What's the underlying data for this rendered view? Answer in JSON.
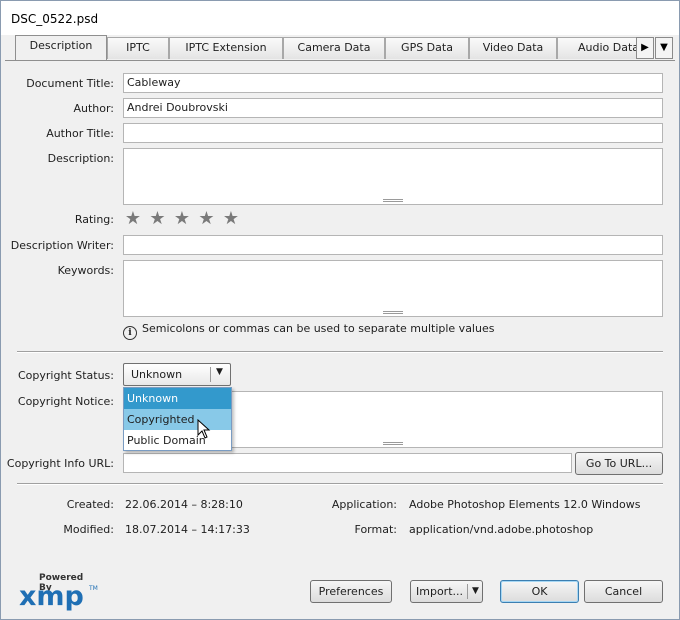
{
  "window": {
    "title": "DSC_0522.psd"
  },
  "tabs": [
    {
      "label": "Description"
    },
    {
      "label": "IPTC"
    },
    {
      "label": "IPTC Extension"
    },
    {
      "label": "Camera Data"
    },
    {
      "label": "GPS Data"
    },
    {
      "label": "Video Data"
    },
    {
      "label": "Audio Data"
    }
  ],
  "active_tab": "Description",
  "tab_scroll": {
    "right_icon": "triangle-right-icon",
    "menu_icon": "triangle-down-icon"
  },
  "form": {
    "document_title": {
      "label": "Document Title:",
      "value": "Cableway"
    },
    "author": {
      "label": "Author:",
      "value": "Andrei Doubrovski"
    },
    "author_title": {
      "label": "Author Title:",
      "value": ""
    },
    "description": {
      "label": "Description:",
      "value": ""
    },
    "rating": {
      "label": "Rating:",
      "stars": 0,
      "max": 5
    },
    "description_writer": {
      "label": "Description Writer:",
      "value": ""
    },
    "keywords": {
      "label": "Keywords:",
      "value": ""
    },
    "keywords_hint": "Semicolons or commas can be used to separate multiple values"
  },
  "copyright": {
    "status_label": "Copyright Status:",
    "status_value": "Unknown",
    "options": [
      "Unknown",
      "Copyrighted",
      "Public Domain"
    ],
    "notice_label": "Copyright Notice:",
    "url_label": "Copyright Info URL:",
    "url_value": "",
    "go_to_url": "Go To URL..."
  },
  "meta": {
    "created_label": "Created:",
    "created_value": "22.06.2014 – 8:28:10",
    "modified_label": "Modified:",
    "modified_value": "18.07.2014 – 14:17:33",
    "application_label": "Application:",
    "application_value": "Adobe Photoshop Elements 12.0 Windows",
    "format_label": "Format:",
    "format_value": "application/vnd.adobe.photoshop"
  },
  "footer": {
    "powered_by": "Powered By",
    "logo_text": "xmp",
    "logo_tm": "TM",
    "preferences": "Preferences",
    "import": "Import...",
    "ok": "OK",
    "cancel": "Cancel"
  },
  "colors": {
    "selection": "#3399cc",
    "hover": "#88c9e8",
    "xmp_blue": "#1f6fb4"
  }
}
